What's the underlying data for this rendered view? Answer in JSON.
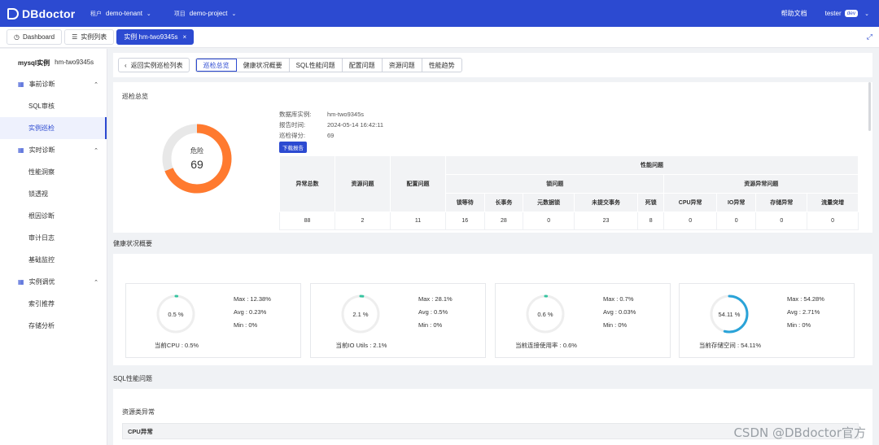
{
  "topbar": {
    "brand": "DBdoctor",
    "tenant_key": "租户",
    "tenant_value": "demo-tenant",
    "project_key": "项目",
    "project_value": "demo-project",
    "help": "帮助文档",
    "user": "tester",
    "env_badge": "dev"
  },
  "tabs": [
    {
      "label": "Dashboard",
      "icon": "dashboard-icon"
    },
    {
      "label": "实例列表",
      "icon": "list-icon"
    },
    {
      "label": "实例 hm-two9345s",
      "active": true
    }
  ],
  "sidebar": {
    "instance_label": "mysql实例",
    "instance_name": "hm-two9345s",
    "groups": [
      {
        "label": "事前诊断",
        "items": [
          "SQL审核",
          "实例巡检"
        ]
      },
      {
        "label": "实时诊断",
        "items": [
          "性能洞察",
          "锁透视",
          "根因诊断",
          "审计日志",
          "基础监控"
        ]
      },
      {
        "label": "实例调优",
        "items": [
          "索引推荐",
          "存储分析"
        ]
      }
    ],
    "active_item": "实例巡检"
  },
  "nav": {
    "back": "返回实例巡检列表",
    "tabs": [
      "巡检总览",
      "健康状况概要",
      "SQL性能问题",
      "配置问题",
      "资源问题",
      "性能趋势"
    ]
  },
  "overview": {
    "title": "巡检总览",
    "level": "危险",
    "score": 69,
    "meta": [
      {
        "k": "数据库实例:",
        "v": "hm-two9345s"
      },
      {
        "k": "报告时间:",
        "v": "2024-05-14 16:42:11"
      },
      {
        "k": "巡检得分:",
        "v": "69"
      }
    ],
    "download": "下载报告",
    "table": {
      "h_total": "异常总数",
      "h_resource": "资源问题",
      "h_config": "配置问题",
      "h_perf": "性能问题",
      "h_lock": "锁问题",
      "h_res_abn": "资源异常问题",
      "lock_cols": [
        "锁等待",
        "长事务",
        "元数据锁",
        "未提交事务",
        "死锁"
      ],
      "res_cols": [
        "CPU异常",
        "IO异常",
        "存储异常",
        "流量突增"
      ],
      "values": [
        "88",
        "2",
        "11",
        "16",
        "28",
        "0",
        "23",
        "8",
        "0",
        "0",
        "0",
        "0"
      ]
    }
  },
  "health": {
    "title": "健康状况概要",
    "gauges": [
      {
        "pct": "0.5 %",
        "value": 0.5,
        "current": "当前CPU : 0.5%",
        "max": "Max :  12.38%",
        "avg": "Avg :  0.23%",
        "min": "Min :   0%"
      },
      {
        "pct": "2.1 %",
        "value": 2.1,
        "current": "当前IO Utils : 2.1%",
        "max": "Max :  28.1%",
        "avg": "Avg :  0.5%",
        "min": "Min :   0%"
      },
      {
        "pct": "0.6 %",
        "value": 0.6,
        "current": "当前连接使用率 : 0.6%",
        "max": "Max :  0.7%",
        "avg": "Avg :  0.03%",
        "min": "Min :   0%"
      },
      {
        "pct": "54.11 %",
        "value": 54.11,
        "current": "当前存储空间 : 54.11%",
        "max": "Max :  54.28%",
        "avg": "Avg :  2.71%",
        "min": "Min :   0%"
      }
    ]
  },
  "sql_perf": {
    "title": "SQL性能问题",
    "sub_title": "资源类异常",
    "cpu_header": "CPU异常"
  },
  "watermark": "CSDN @DBdoctor官方",
  "colors": {
    "primary": "#2c4ad1",
    "danger": "#ff7a2f",
    "gauge_low": "#36c4a0",
    "gauge_mid": "#2aa3d8"
  }
}
